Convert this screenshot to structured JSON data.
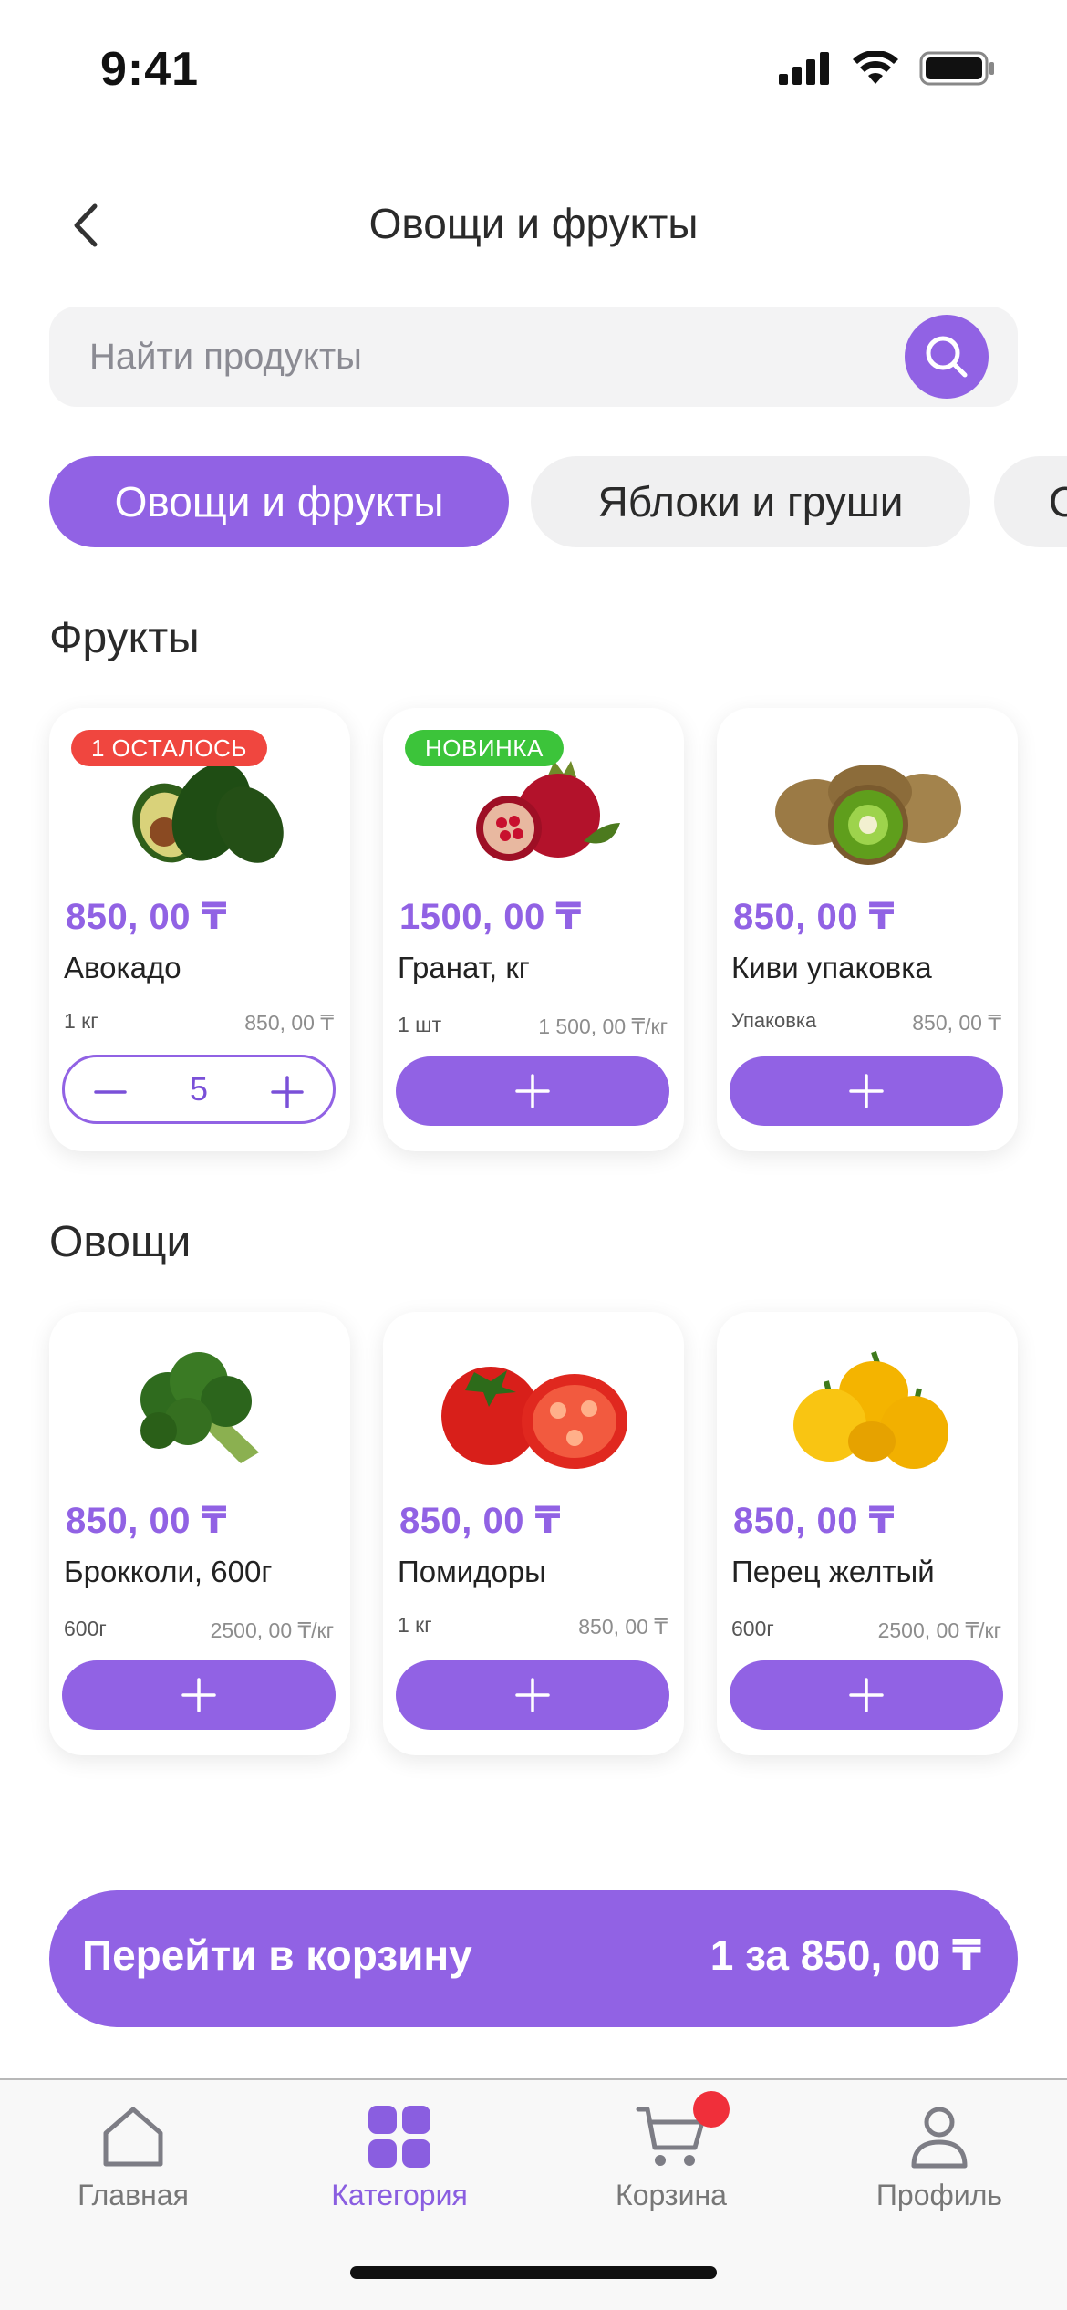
{
  "status_bar": {
    "time": "9:41"
  },
  "header": {
    "title": "Овощи и фрукты"
  },
  "search": {
    "placeholder": "Найти продукты",
    "value": ""
  },
  "categories": [
    {
      "label": "Овощи и фрукты",
      "active": true
    },
    {
      "label": "Яблоки и груши",
      "active": false
    },
    {
      "label": "С",
      "active": false
    }
  ],
  "sections": [
    {
      "title": "Фрукты",
      "products": [
        {
          "badge": "1 ОСТАЛОСЬ",
          "badge_color": "#f0463f",
          "image": "avocado-image",
          "price": "850, 00 ₸",
          "name": "Авокадо",
          "unit": "1 кг",
          "unit_price": "850, 00 ₸",
          "quantity": "5"
        },
        {
          "badge": "НОВИНКА",
          "badge_color": "#3cc43a",
          "image": "pomegranate-image",
          "price": "1500, 00 ₸",
          "name": "Гранат, кг",
          "unit": "1 шт",
          "unit_price": "1 500, 00 ₸/кг"
        },
        {
          "image": "kiwi-image",
          "price": "850, 00 ₸",
          "name": "Киви упаковка",
          "unit": "Упаковка",
          "unit_price": "850, 00 ₸"
        }
      ]
    },
    {
      "title": "Овощи",
      "products": [
        {
          "image": "broccoli-image",
          "price": "850, 00 ₸",
          "name": "Брокколи, 600г",
          "unit": "600г",
          "unit_price": "2500, 00 ₸/кг"
        },
        {
          "image": "tomatoes-image",
          "price": "850, 00 ₸",
          "name": "Помидоры",
          "unit": "1 кг",
          "unit_price": "850, 00 ₸"
        },
        {
          "image": "yellow-pepper-image",
          "price": "850, 00 ₸",
          "name": "Перец желтый",
          "unit": "600г",
          "unit_price": "2500, 00 ₸/кг"
        }
      ]
    }
  ],
  "cart_cta": {
    "label": "Перейти в корзину",
    "summary": "1 за 850, 00 ₸"
  },
  "tabbar": {
    "items": [
      {
        "label": "Главная",
        "icon": "home-icon",
        "active": false
      },
      {
        "label": "Категория",
        "icon": "grid-icon",
        "active": true
      },
      {
        "label": "Корзина",
        "icon": "cart-icon",
        "active": false,
        "has_dot": true
      },
      {
        "label": "Профиль",
        "icon": "profile-icon",
        "active": false
      }
    ]
  },
  "colors": {
    "accent": "#9162e4",
    "badge_red": "#f0463f",
    "badge_green": "#3cc43a",
    "cart_dot": "#f02f3a"
  }
}
